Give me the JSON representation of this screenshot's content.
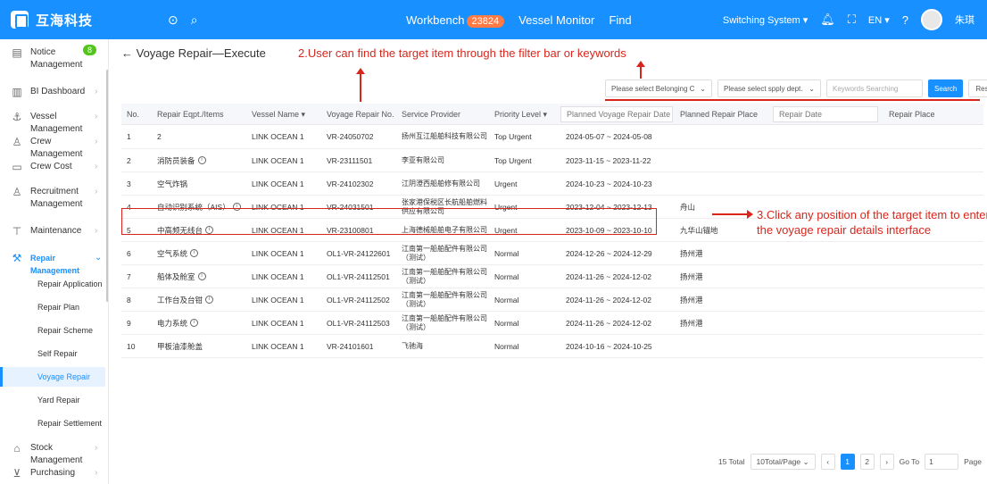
{
  "topbar": {
    "logo_text": "互海科技",
    "nav": [
      {
        "label": "Workbench",
        "badge": "23824"
      },
      {
        "label": "Vessel Monitor"
      },
      {
        "label": "Find"
      }
    ],
    "switching": "Switching System ▾",
    "lang": "EN ▾",
    "user": "朱琪"
  },
  "sidebar": {
    "items": [
      {
        "label": "Notice Management",
        "icon": "notice-icon",
        "count": "8"
      },
      {
        "label": "BI Dashboard",
        "icon": "chart-icon"
      },
      {
        "label": "Vessel Management",
        "icon": "anchor-icon"
      },
      {
        "label": "Crew Management",
        "icon": "user-icon"
      },
      {
        "label": "Crew Cost",
        "icon": "card-icon"
      },
      {
        "label": "Recruitment Management",
        "icon": "user-icon"
      },
      {
        "label": "Maintenance",
        "icon": "wrench-icon"
      },
      {
        "label": "Repair Management",
        "icon": "repair-icon"
      },
      {
        "label": "Stock Management",
        "icon": "warehouse-icon"
      },
      {
        "label": "Purchasing",
        "icon": "cart-icon"
      }
    ],
    "sub_items": [
      "Repair Application",
      "Repair Plan",
      "Repair Scheme",
      "Self Repair",
      "Voyage Repair",
      "Yard Repair",
      "Repair Settlement"
    ]
  },
  "page": {
    "title": "← Voyage Repair—Execute",
    "annotation_2": "2.User can find the target item through the filter bar or keywords",
    "annotation_3": "3.Click any position of the target item to enter the voyage repair details interface"
  },
  "filters": {
    "belonging": "Please select Belonging C",
    "dept": "Please select spply dept.",
    "keywords_placeholder": "Keywords Searching",
    "search": "Search",
    "reset": "Reset"
  },
  "table": {
    "headers": [
      "No.",
      "Repair Eqpt./Items",
      "Vessel Name ▾",
      "Voyage Repair No.",
      "Service Provider",
      "Priority Level ▾",
      "Planned Voyage Repair Date",
      "Planned Repair Place",
      "Repair Date",
      "Repair Place"
    ],
    "rows": [
      {
        "no": "1",
        "item": "2",
        "info": false,
        "vessel": "LINK OCEAN 1",
        "repair_no": "VR-24050702",
        "provider": "扬州互江船舶科技有限公司",
        "priority": "Top Urgent",
        "date": "2024-05-07 ~ 2024-05-08",
        "place": ""
      },
      {
        "no": "2",
        "item": "消防员装备",
        "info": true,
        "vessel": "LINK OCEAN 1",
        "repair_no": "VR-23111501",
        "provider": "李亚有限公司",
        "priority": "Top Urgent",
        "date": "2023-11-15 ~ 2023-11-22",
        "place": ""
      },
      {
        "no": "3",
        "item": "空气炸锅",
        "info": false,
        "vessel": "LINK OCEAN 1",
        "repair_no": "VR-24102302",
        "provider": "江阴澄西船舶修有限公司",
        "priority": "Urgent",
        "date": "2024-10-23 ~ 2024-10-23",
        "place": ""
      },
      {
        "no": "4",
        "item": "自动识别系统（AIS）",
        "info": true,
        "vessel": "LINK OCEAN 1",
        "repair_no": "VR-24031501",
        "provider": "张家港保税区长航船舶燃料供应有限公司",
        "priority": "Urgent",
        "date": "2023-12-04 ~ 2023-12-13",
        "place": "舟山"
      },
      {
        "no": "5",
        "item": "中高频无线台",
        "info": true,
        "vessel": "LINK OCEAN 1",
        "repair_no": "VR-23100801",
        "provider": "上海德械船舶电子有限公司",
        "priority": "Urgent",
        "date": "2023-10-09 ~ 2023-10-10",
        "place": "九华山锚地"
      },
      {
        "no": "6",
        "item": "空气系统",
        "info": true,
        "vessel": "LINK OCEAN 1",
        "repair_no": "OL1-VR-24122601",
        "provider": "江南第一船舶配件有限公司（测试）",
        "priority": "Normal",
        "date": "2024-12-26 ~ 2024-12-29",
        "place": "扬州港"
      },
      {
        "no": "7",
        "item": "船体及舱室",
        "info": true,
        "vessel": "LINK OCEAN 1",
        "repair_no": "OL1-VR-24112501",
        "provider": "江南第一船舶配件有限公司（测试）",
        "priority": "Normal",
        "date": "2024-11-26 ~ 2024-12-02",
        "place": "扬州港"
      },
      {
        "no": "8",
        "item": "工作台及台钳",
        "info": true,
        "vessel": "LINK OCEAN 1",
        "repair_no": "OL1-VR-24112502",
        "provider": "江南第一船舶配件有限公司（测试）",
        "priority": "Normal",
        "date": "2024-11-26 ~ 2024-12-02",
        "place": "扬州港"
      },
      {
        "no": "9",
        "item": "电力系统",
        "info": true,
        "vessel": "LINK OCEAN 1",
        "repair_no": "OL1-VR-24112503",
        "provider": "江南第一船舶配件有限公司（测试）",
        "priority": "Normal",
        "date": "2024-11-26 ~ 2024-12-02",
        "place": "扬州港"
      },
      {
        "no": "10",
        "item": "甲板油漆舱盖",
        "info": false,
        "vessel": "LINK OCEAN 1",
        "repair_no": "VR-24101601",
        "provider": "飞驰海",
        "priority": "Normal",
        "date": "2024-10-16 ~ 2024-10-25",
        "place": ""
      }
    ]
  },
  "pagination": {
    "total": "15 Total",
    "per_page": "10Total/Page",
    "pages": [
      "1",
      "2"
    ],
    "goto_label": "Go To",
    "goto_value": "1",
    "page_label": "Page"
  },
  "colors": {
    "primary": "#1890ff",
    "annotation": "#d9261c",
    "badge": "#ff7a45",
    "notice_count": "#52c41a"
  }
}
